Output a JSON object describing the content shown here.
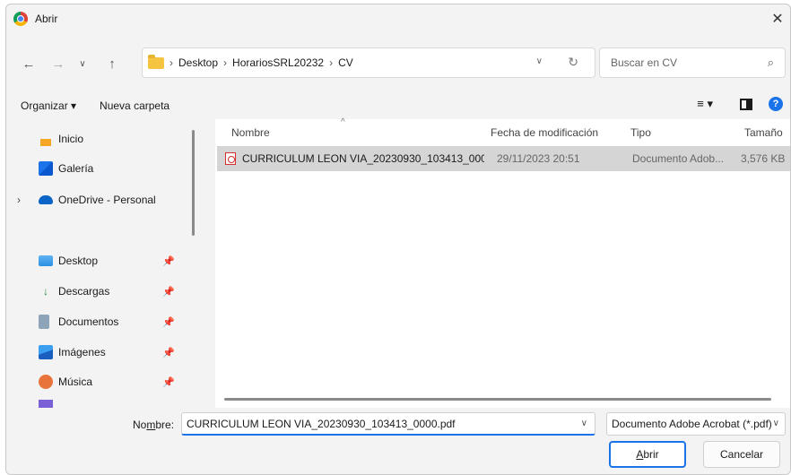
{
  "window": {
    "title": "Abrir",
    "close_glyph": "✕"
  },
  "nav": {
    "back": "←",
    "forward": "→",
    "recent": "∨",
    "up": "↑"
  },
  "address": {
    "crumbs": [
      "Desktop",
      "HorariosSRL20232",
      "CV"
    ],
    "separator": "›",
    "dropdown": "∨",
    "refresh": "↻"
  },
  "search": {
    "placeholder": "Buscar en CV",
    "icon": "⌕"
  },
  "toolbar": {
    "organize_label": "Organizar ▾",
    "new_folder_label": "Nueva carpeta",
    "view_glyph": "≡ ▾",
    "help_glyph": "?"
  },
  "sidebar": {
    "items": [
      {
        "label": "Inicio",
        "icon": "home-icon"
      },
      {
        "label": "Galería",
        "icon": "gallery-icon"
      },
      {
        "label": "OneDrive - Personal",
        "icon": "onedrive-icon",
        "expand": "›"
      },
      {
        "label": "Desktop",
        "icon": "desktop-icon",
        "pinned": true
      },
      {
        "label": "Descargas",
        "icon": "download-icon",
        "pinned": true
      },
      {
        "label": "Documentos",
        "icon": "documents-icon",
        "pinned": true
      },
      {
        "label": "Imágenes",
        "icon": "pictures-icon",
        "pinned": true
      },
      {
        "label": "Música",
        "icon": "music-icon",
        "pinned": true
      }
    ],
    "pin_glyph": "📌"
  },
  "columns": {
    "name": "Nombre",
    "date": "Fecha de modificación",
    "type": "Tipo",
    "size": "Tamaño",
    "sort_glyph": "^"
  },
  "files": [
    {
      "name": "CURRICULUM LEON VIA_20230930_103413_000...",
      "date": "29/11/2023 20:51",
      "type": "Documento Adob...",
      "size": "3,576 KB"
    }
  ],
  "footer": {
    "filename_label_pre": "No",
    "filename_label_u": "m",
    "filename_label_post": "bre:",
    "filename_value": "CURRICULUM LEON VIA_20230930_103413_0000.pdf",
    "filetype_value": "Documento Adobe Acrobat (*.pdf)",
    "dropdown": "∨",
    "open_u": "A",
    "open_rest": "brir",
    "cancel_label": "Cancelar"
  },
  "colors": {
    "accent": "#1a73e8",
    "selection": "#cce4f7",
    "folder": "#f5c542",
    "pdf": "#d32f2f"
  }
}
